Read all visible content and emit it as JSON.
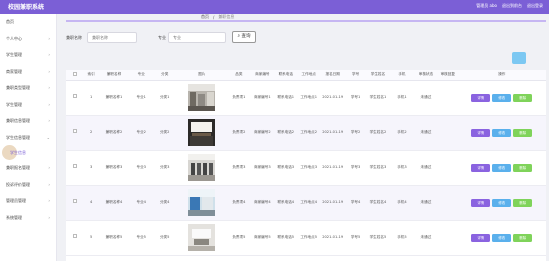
{
  "app": {
    "title": "校园兼职系统"
  },
  "topbar": {
    "items": [
      "管理员 abo",
      "退出到前台",
      "退出登录"
    ]
  },
  "sidebar": {
    "items": [
      {
        "label": "首页",
        "arrow": ""
      },
      {
        "label": "个人中心",
        "arrow": "›"
      },
      {
        "label": "学生管理",
        "arrow": "›"
      },
      {
        "label": "商家管理",
        "arrow": "›"
      },
      {
        "label": "兼职类型管理",
        "arrow": "›"
      },
      {
        "label": "学生管理",
        "arrow": "›"
      },
      {
        "label": "兼职信息管理",
        "arrow": "›"
      },
      {
        "label": "学生信息管理",
        "arrow": "›"
      }
    ],
    "sub_item": "学生信息",
    "items_after": [
      {
        "label": "兼职报名管理",
        "arrow": "›"
      },
      {
        "label": "投诉评价管理",
        "arrow": "›"
      },
      {
        "label": "管理员管理",
        "arrow": "›"
      },
      {
        "label": "系统管理",
        "arrow": "›"
      }
    ]
  },
  "breadcrumb": {
    "home": "首页",
    "sep": "/",
    "current": "兼职信息"
  },
  "search": {
    "label1": "兼职名称",
    "placeholder1": "兼职名称",
    "label2": "专业",
    "placeholder2": "专业",
    "button": "查询"
  },
  "table": {
    "headers": [
      "",
      "索引",
      "兼职名称",
      "专业",
      "分类",
      "图片",
      "品类",
      "商家编号",
      "联系电话",
      "工作地点",
      "报名日期",
      "学号",
      "学生姓名",
      "手机",
      "审核状态",
      "审核回复",
      "操作"
    ],
    "rows": [
      [
        "1",
        "兼职名称1",
        "专业1",
        "分类1",
        "",
        "负责项1",
        "商家编号1",
        "联系电话1",
        "工作地点1",
        "2021-01-19",
        "学号1",
        "学生姓名1",
        "手机1",
        "未通过",
        ""
      ],
      [
        "2",
        "兼职名称2",
        "专业2",
        "分类2",
        "",
        "负责项2",
        "商家编号2",
        "联系电话2",
        "工作地点2",
        "2021-01-19",
        "学号2",
        "学生姓名2",
        "手机2",
        "未通过",
        ""
      ],
      [
        "3",
        "兼职名称3",
        "专业3",
        "分类3",
        "",
        "负责项3",
        "商家编号3",
        "联系电话3",
        "工作地点3",
        "2021-01-19",
        "学号3",
        "学生姓名3",
        "手机3",
        "未通过",
        ""
      ],
      [
        "4",
        "兼职名称4",
        "专业4",
        "分类4",
        "",
        "负责项4",
        "商家编号4",
        "联系电话4",
        "工作地点4",
        "2021-01-19",
        "学号4",
        "学生姓名4",
        "手机4",
        "未通过",
        ""
      ],
      [
        "5",
        "兼职名称5",
        "专业5",
        "分类5",
        "",
        "负责项5",
        "商家编号5",
        "联系电话5",
        "工作地点5",
        "2021-01-19",
        "学号5",
        "学生姓名5",
        "手机5",
        "未通过",
        ""
      ]
    ],
    "ops": {
      "detail": "详情",
      "edit": "修改",
      "del": "删除"
    }
  },
  "colors": {
    "accent": "#7b5fd6",
    "detail": "#8a63e0",
    "edit": "#5ab0ec",
    "del": "#7fd35a"
  }
}
